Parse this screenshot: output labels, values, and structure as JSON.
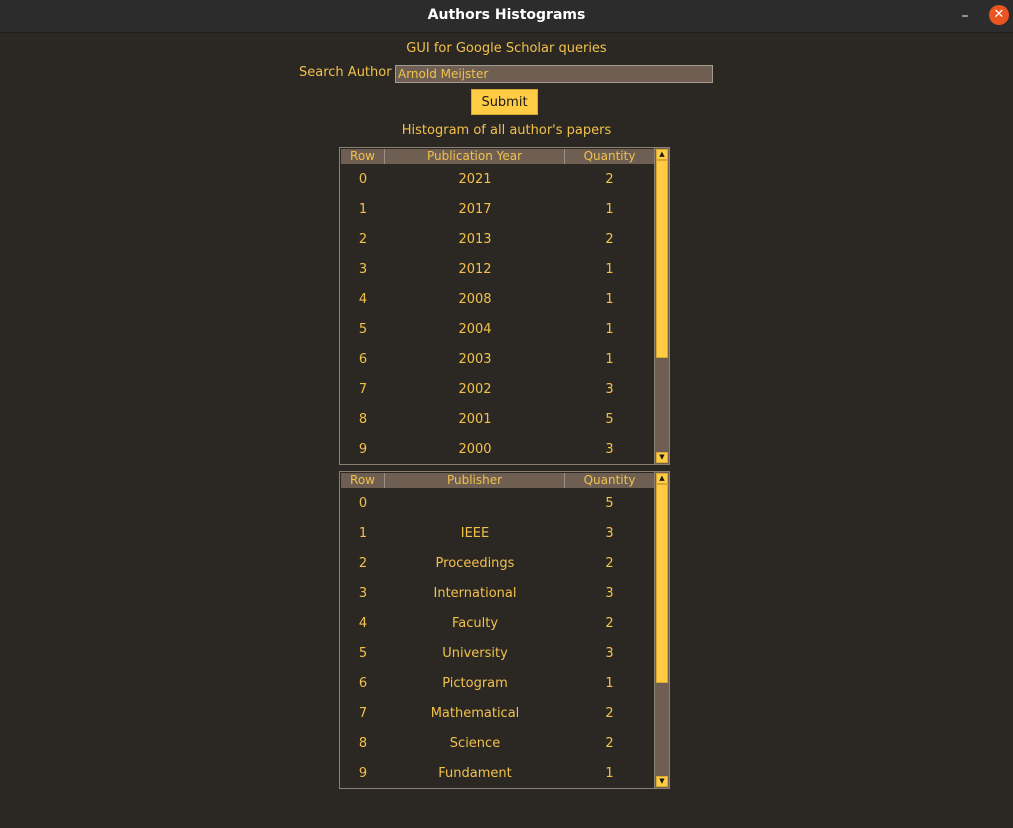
{
  "window": {
    "title": "Authors Histograms",
    "minimize_label": "–",
    "close_label": "✕"
  },
  "header": {
    "subtitle": "GUI for Google Scholar queries",
    "search_label": "Search Author",
    "search_value": "Arnold Meijster",
    "submit_label": "Submit",
    "histogram_label": "Histogram of all author's papers"
  },
  "year_table": {
    "headers": [
      "Row",
      "Publication Year",
      "Quantity"
    ],
    "rows": [
      {
        "row": "0",
        "value": "2021",
        "qty": "2"
      },
      {
        "row": "1",
        "value": "2017",
        "qty": "1"
      },
      {
        "row": "2",
        "value": "2013",
        "qty": "2"
      },
      {
        "row": "3",
        "value": "2012",
        "qty": "1"
      },
      {
        "row": "4",
        "value": "2008",
        "qty": "1"
      },
      {
        "row": "5",
        "value": "2004",
        "qty": "1"
      },
      {
        "row": "6",
        "value": "2003",
        "qty": "1"
      },
      {
        "row": "7",
        "value": "2002",
        "qty": "3"
      },
      {
        "row": "8",
        "value": "2001",
        "qty": "5"
      },
      {
        "row": "9",
        "value": "2000",
        "qty": "3"
      }
    ]
  },
  "publisher_table": {
    "headers": [
      "Row",
      "Publisher",
      "Quantity"
    ],
    "rows": [
      {
        "row": "0",
        "value": "",
        "qty": "5"
      },
      {
        "row": "1",
        "value": "IEEE",
        "qty": "3"
      },
      {
        "row": "2",
        "value": "Proceedings",
        "qty": "2"
      },
      {
        "row": "3",
        "value": "International",
        "qty": "3"
      },
      {
        "row": "4",
        "value": "Faculty",
        "qty": "2"
      },
      {
        "row": "5",
        "value": "University",
        "qty": "3"
      },
      {
        "row": "6",
        "value": "Pictogram",
        "qty": "1"
      },
      {
        "row": "7",
        "value": "Mathematical",
        "qty": "2"
      },
      {
        "row": "8",
        "value": "Science",
        "qty": "2"
      },
      {
        "row": "9",
        "value": "Fundament",
        "qty": "1"
      }
    ]
  },
  "icons": {
    "scroll_up": "arrow-up-icon",
    "scroll_down": "arrow-down-icon"
  },
  "colors": {
    "background": "#2b2824",
    "text": "#f2c14b",
    "header_bg": "#6e5f52",
    "accent": "#ffcc44",
    "close": "#e95420"
  }
}
